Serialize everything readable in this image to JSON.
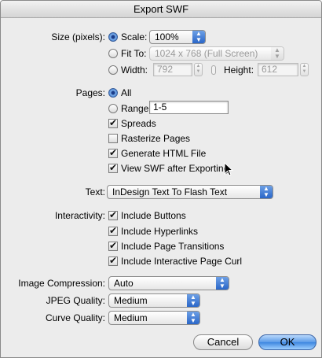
{
  "window": {
    "title": "Export SWF"
  },
  "size": {
    "label": "Size (pixels):",
    "scale_label": "Scale:",
    "scale_value": "100%",
    "fit_label": "Fit To:",
    "fit_value": "1024 x 768 (Full Screen)",
    "width_label": "Width:",
    "width_value": "792",
    "height_label": "Height:",
    "height_value": "612"
  },
  "pages": {
    "label": "Pages:",
    "all_label": "All",
    "range_label": "Range:",
    "range_value": "1-5",
    "spreads_label": "Spreads",
    "spreads_checked": true,
    "rasterize_label": "Rasterize Pages",
    "rasterize_checked": false,
    "html_label": "Generate HTML File",
    "html_checked": true,
    "view_label": "View SWF after Exporting",
    "view_checked": true
  },
  "text": {
    "label": "Text:",
    "value": "InDesign Text To Flash Text"
  },
  "interactivity": {
    "label": "Interactivity:",
    "buttons_label": "Include Buttons",
    "hyperlinks_label": "Include Hyperlinks",
    "transitions_label": "Include Page Transitions",
    "curl_label": "Include Interactive Page Curl"
  },
  "image": {
    "compression_label": "Image Compression:",
    "compression_value": "Auto",
    "jpeg_label": "JPEG Quality:",
    "jpeg_value": "Medium",
    "curve_label": "Curve Quality:",
    "curve_value": "Medium"
  },
  "buttons": {
    "cancel": "Cancel",
    "ok": "OK"
  }
}
